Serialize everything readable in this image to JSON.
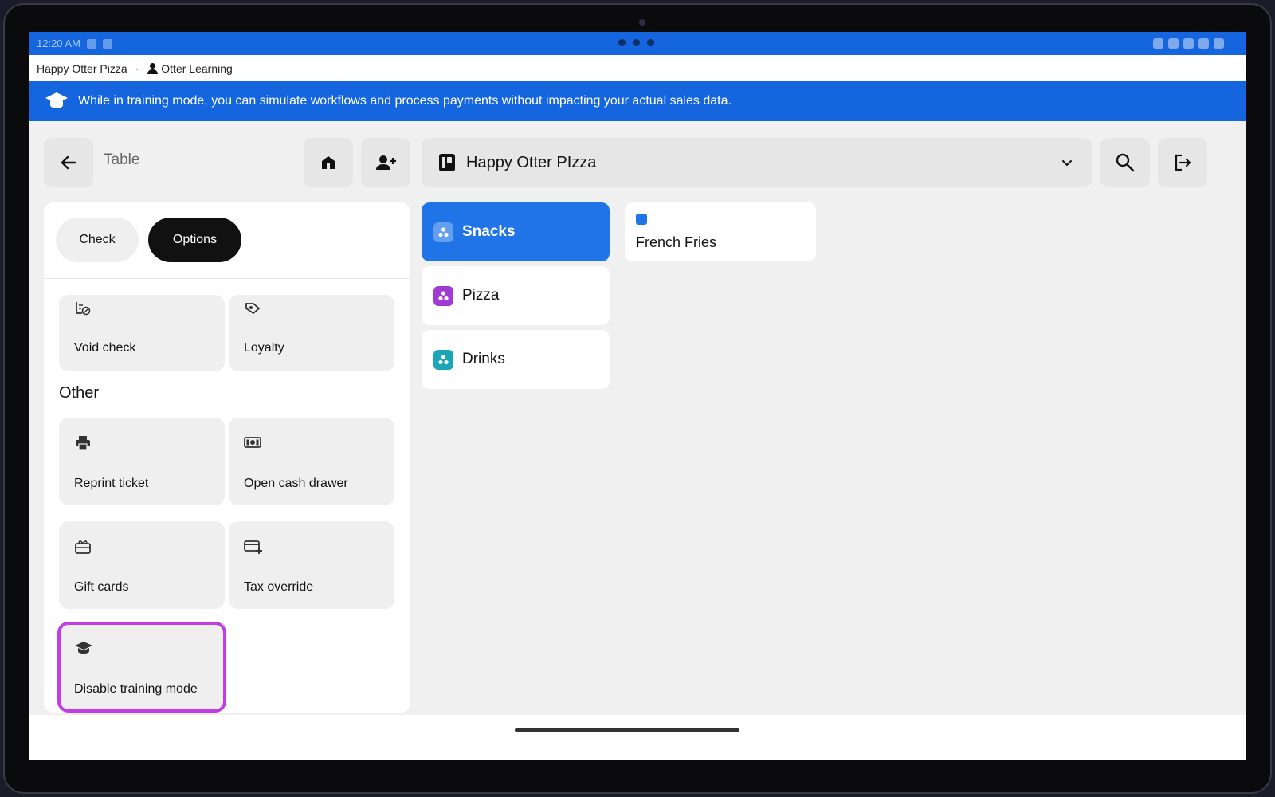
{
  "status_bar": {
    "time": "12:20 AM"
  },
  "subheader": {
    "restaurant": "Happy Otter Pizza",
    "separator": "·",
    "user": "Otter Learning"
  },
  "banner": {
    "message": "While in training mode, you can simulate workflows and process payments without impacting your actual sales data."
  },
  "topbar": {
    "table_label": "Table",
    "venue": "Happy Otter PIzza"
  },
  "panel": {
    "tabs": {
      "check": "Check",
      "options": "Options"
    },
    "cards": {
      "void_check": "Void check",
      "loyalty": "Loyalty",
      "reprint_ticket": "Reprint ticket",
      "open_cash_drawer": "Open cash drawer",
      "gift_cards": "Gift cards",
      "tax_override": "Tax override",
      "disable_training_mode": "Disable training mode"
    },
    "other_section_title": "Other",
    "highlight_color": "#c33ce6"
  },
  "categories": [
    {
      "label": "Snacks",
      "color": "#2174e8",
      "active": true
    },
    {
      "label": "Pizza",
      "color": "#a23bd6",
      "active": false
    },
    {
      "label": "Drinks",
      "color": "#1aa6b7",
      "active": false
    }
  ],
  "items": [
    {
      "label": "French Fries",
      "color": "#2174e8"
    }
  ],
  "colors": {
    "primary": "#1565df",
    "accent": "#2174e8",
    "dark_tab": "#111111"
  }
}
